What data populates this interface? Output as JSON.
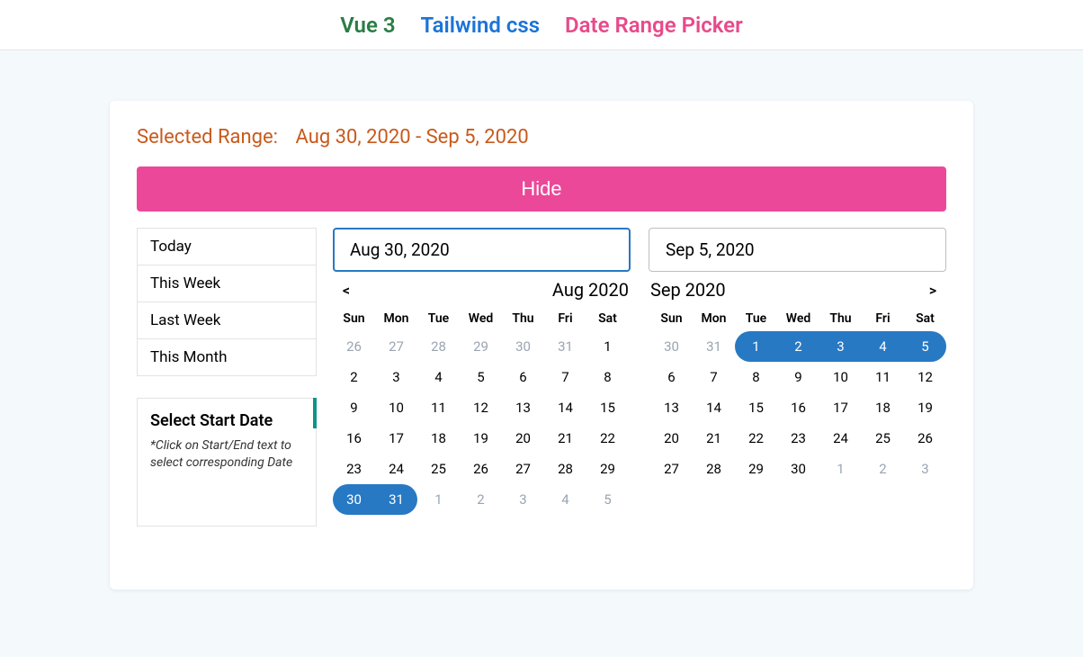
{
  "topbar": {
    "vue": "Vue 3",
    "tw": "Tailwind css",
    "drp": "Date Range Picker"
  },
  "selected": {
    "label": "Selected Range:",
    "value": "Aug 30, 2020 - Sep 5, 2020"
  },
  "hide": "Hide",
  "presets": [
    "Today",
    "This Week",
    "Last Week",
    "This Month"
  ],
  "help": {
    "title": "Select Start Date",
    "sub": "*Click on Start/End text to select corresponding Date"
  },
  "inputs": {
    "start": "Aug 30, 2020",
    "end": "Sep 5, 2020"
  },
  "nav": {
    "prev": "<",
    "next": ">"
  },
  "dow": [
    "Sun",
    "Mon",
    "Tue",
    "Wed",
    "Thu",
    "Fri",
    "Sat"
  ],
  "months": {
    "left": {
      "label": "Aug 2020",
      "weeks": [
        [
          {
            "d": 26,
            "o": true
          },
          {
            "d": 27,
            "o": true
          },
          {
            "d": 28,
            "o": true
          },
          {
            "d": 29,
            "o": true
          },
          {
            "d": 30,
            "o": true
          },
          {
            "d": 31,
            "o": true
          },
          {
            "d": 1
          }
        ],
        [
          {
            "d": 2
          },
          {
            "d": 3
          },
          {
            "d": 4
          },
          {
            "d": 5
          },
          {
            "d": 6
          },
          {
            "d": 7
          },
          {
            "d": 8
          }
        ],
        [
          {
            "d": 9
          },
          {
            "d": 10
          },
          {
            "d": 11
          },
          {
            "d": 12
          },
          {
            "d": 13
          },
          {
            "d": 14
          },
          {
            "d": 15
          }
        ],
        [
          {
            "d": 16
          },
          {
            "d": 17
          },
          {
            "d": 18
          },
          {
            "d": 19
          },
          {
            "d": 20
          },
          {
            "d": 21
          },
          {
            "d": 22
          }
        ],
        [
          {
            "d": 23
          },
          {
            "d": 24
          },
          {
            "d": 25
          },
          {
            "d": 26
          },
          {
            "d": 27
          },
          {
            "d": 28
          },
          {
            "d": 29
          }
        ],
        [
          {
            "d": 30,
            "s": true,
            "start": true
          },
          {
            "d": 31,
            "s": true,
            "end": true
          },
          {
            "d": 1,
            "o": true
          },
          {
            "d": 2,
            "o": true
          },
          {
            "d": 3,
            "o": true
          },
          {
            "d": 4,
            "o": true
          },
          {
            "d": 5,
            "o": true
          }
        ]
      ]
    },
    "right": {
      "label": "Sep 2020",
      "weeks": [
        [
          {
            "d": 30,
            "o": true
          },
          {
            "d": 31,
            "o": true
          },
          {
            "d": 1,
            "s": true,
            "start": true
          },
          {
            "d": 2,
            "s": true
          },
          {
            "d": 3,
            "s": true
          },
          {
            "d": 4,
            "s": true
          },
          {
            "d": 5,
            "s": true,
            "end": true
          }
        ],
        [
          {
            "d": 6
          },
          {
            "d": 7
          },
          {
            "d": 8
          },
          {
            "d": 9
          },
          {
            "d": 10
          },
          {
            "d": 11
          },
          {
            "d": 12
          }
        ],
        [
          {
            "d": 13
          },
          {
            "d": 14
          },
          {
            "d": 15
          },
          {
            "d": 16
          },
          {
            "d": 17
          },
          {
            "d": 18
          },
          {
            "d": 19
          }
        ],
        [
          {
            "d": 20
          },
          {
            "d": 21
          },
          {
            "d": 22
          },
          {
            "d": 23
          },
          {
            "d": 24
          },
          {
            "d": 25
          },
          {
            "d": 26
          }
        ],
        [
          {
            "d": 27
          },
          {
            "d": 28
          },
          {
            "d": 29
          },
          {
            "d": 30
          },
          {
            "d": 1,
            "o": true
          },
          {
            "d": 2,
            "o": true
          },
          {
            "d": 3,
            "o": true
          }
        ]
      ]
    }
  }
}
